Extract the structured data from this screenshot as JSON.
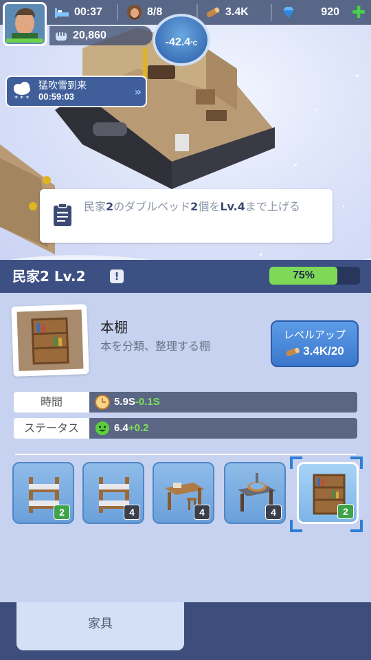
{
  "topbar": {
    "timer": "00:37",
    "population": "8/8",
    "wood": "3.4K",
    "gems": "920",
    "power": "20,860"
  },
  "temperature": {
    "value": "-42.4",
    "unit": "°C"
  },
  "weather": {
    "name": "猛吹雪到来",
    "countdown": "00:59:03"
  },
  "quest": {
    "parts": [
      "民家",
      "2",
      "のダブルベッド",
      "2",
      "個を",
      "Lv.4",
      "まで上げる"
    ]
  },
  "building": {
    "title": "民家2 Lv.2",
    "warn": "!",
    "progress_percent": 75,
    "progress_label": "75%"
  },
  "item": {
    "name": "本棚",
    "description": "本を分類、整理する棚",
    "upgrade_label": "レベルアップ",
    "upgrade_cost": "3.4K/20"
  },
  "stats": [
    {
      "label": "時間",
      "value": "5.9S",
      "delta": "-0.1S"
    },
    {
      "label": "ステータス",
      "value": "6.4",
      "delta": "+0.2"
    }
  ],
  "furniture": [
    {
      "icon": "bunk-bed-icon",
      "level": "2",
      "badge_color": "green"
    },
    {
      "icon": "bunk-bed-icon",
      "level": "4",
      "badge_color": "dark"
    },
    {
      "icon": "desk-icon",
      "level": "4",
      "badge_color": "dark"
    },
    {
      "icon": "wash-basin-icon",
      "level": "4",
      "badge_color": "dark"
    },
    {
      "icon": "bookshelf-icon",
      "level": "2",
      "badge_color": "green"
    }
  ],
  "tabs": {
    "furniture": "家具"
  },
  "colors": {
    "panel": "#c6d2ef",
    "header": "#3d5084",
    "accent_green": "#7fd957",
    "button_blue": "#3b77cc"
  }
}
